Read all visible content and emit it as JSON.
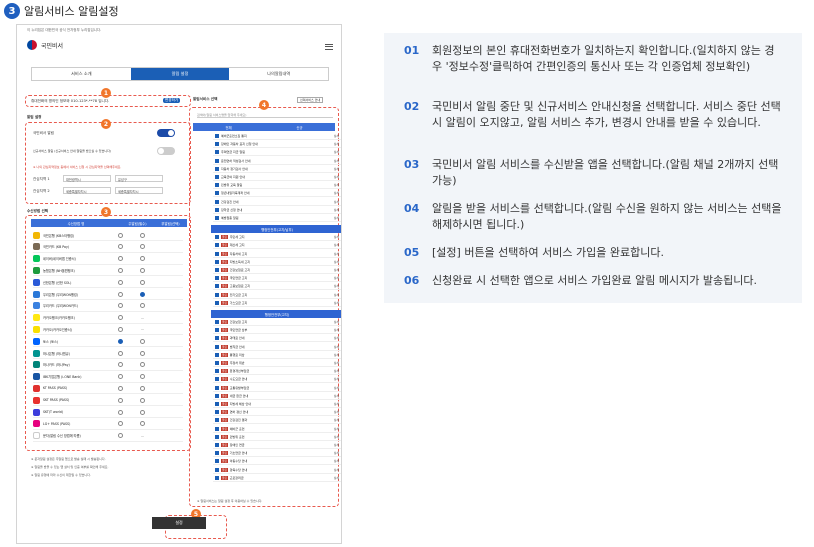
{
  "section": {
    "number": "3",
    "title": "알림서비스 알림설정"
  },
  "phone": {
    "top_note": "이 누리집은 대한민국 공식 전자정부 누리집입니다.",
    "brand": "국민비서",
    "tabs": [
      "서비스 소개",
      "알림 설정",
      "나의알림내역"
    ],
    "verify_text": "휴대전화의 명의인 정보와 010-123*-**78 입니다.",
    "verify_btn": "변경하기",
    "alarm_setting_label": "알림 설정",
    "stop_label": "국민비서 알림",
    "new_service_label": "신규서비스 알림 (신규서비스 안내 알림을 받으실 수 있습니다)",
    "region_note": "※ 나의 관심지역정보 등에서 서비스 신청 시 관심지역을 선택해주세요.",
    "region1_label": "관심지역 1",
    "region1_a": "대전광역시",
    "region1_b": "유성구",
    "region2_label": "관심지역 2",
    "region2_a": "세종특별자치시",
    "region2_b": "세종특별자치시",
    "app_section_label": "수신방법 선택",
    "app_head": [
      "수신방법 명",
      "주알림(필수)",
      "부알림(선택)"
    ],
    "apps": [
      {
        "name": "국민은행 (KB스타뱅킹)",
        "color": "#f2b705",
        "main": false,
        "sub": "radio"
      },
      {
        "name": "국민카드 (KB Pay)",
        "color": "#7a6a55",
        "main": false,
        "sub": "radio"
      },
      {
        "name": "네이버(네이버앱 인증서)",
        "color": "#03c75a",
        "main": false,
        "sub": "radio"
      },
      {
        "name": "농협은행 (NH올원뱅크)",
        "color": "#1d9b3e",
        "main": false,
        "sub": "radio"
      },
      {
        "name": "신한은행 (신한 SOL)",
        "color": "#2a5ad8",
        "main": false,
        "sub": "radio"
      },
      {
        "name": "우리은행 (우리WON뱅킹)",
        "color": "#2a78d8",
        "main": false,
        "sub": "radio-on"
      },
      {
        "name": "우리카드 (우리WON카드)",
        "color": "#3b82e0",
        "main": false,
        "sub": "radio"
      },
      {
        "name": "카카오뱅크(카카오뱅크)",
        "color": "#ffe812",
        "main": false,
        "sub": "-"
      },
      {
        "name": "카카오(카카오인증서)",
        "color": "#f9e000",
        "main": false,
        "sub": "-"
      },
      {
        "name": "토스 (토스)",
        "color": "#0064ff",
        "main": true,
        "sub": "radio"
      },
      {
        "name": "하나은행 (하나원큐)",
        "color": "#009490",
        "main": false,
        "sub": "radio"
      },
      {
        "name": "하나카드 (하나Pay)",
        "color": "#00857a",
        "main": false,
        "sub": "radio"
      },
      {
        "name": "IBK기업은행 (i-ONE Bank)",
        "color": "#1855a3",
        "main": false,
        "sub": "radio"
      },
      {
        "name": "KT PASS (PASS)",
        "color": "#e0312e",
        "main": false,
        "sub": "radio"
      },
      {
        "name": "SKT PASS (PASS)",
        "color": "#e8312e",
        "main": false,
        "sub": "radio"
      },
      {
        "name": "SKT(T world)",
        "color": "#3c3cdc",
        "main": false,
        "sub": "radio"
      },
      {
        "name": "LG+ PASS (PASS)",
        "color": "#e6007e",
        "main": false,
        "sub": "radio"
      },
      {
        "name": "문자(알림 수신 방법에 따름)",
        "color": "#ffffff",
        "main": false,
        "sub": "-"
      }
    ],
    "footnotes": [
      "※ 문자알림 설정은 주알림 앱으로 발송 실패 시 발송됩니다.",
      "※ 알림을 받을 수 있는 앱 설치 및 인증 여부를 확인해 주세요.",
      "※ 알림 유형에 따라 수신이 제한될 수 있습니다."
    ],
    "svc_label": "알림서비스 선택",
    "svc_search_placeholder": "검색어(알림 서비스명을 입력해 주세요)",
    "svc_all_btn": "선택서비스 안내",
    "svc_head": [
      "전체",
      "신규"
    ],
    "svc_group1": [
      "예비군훈련소집 통지",
      "장애인 자동차 표지 신청 안내",
      "주택연금 지급 알림",
      "운전면허 적성검사 안내",
      "자동차 정기검사 안내",
      "교육급여 지원 안내",
      "민방위 교육 알림",
      "청년내일저축계좌 안내",
      "건강검진 안내",
      "장학금 신청 안내",
      "예방접종 알림"
    ],
    "grp_head1": "행정안전부(고지/납부)",
    "svc_group2": [
      "주민세 고지",
      "재산세 고지",
      "자동차세 고지",
      "지방소득세 고지",
      "건강보험료 고지",
      "국민연금 고지",
      "고용보험료 고지",
      "전기요금 고지",
      "가스요금 고지"
    ],
    "grp_head2": "행정안전부(고지)",
    "svc_group3": [
      "건강보험 고지",
      "국민연금 납부",
      "과태료 안내",
      "범칙금 안내",
      "통행료 미납",
      "주정차 위반",
      "환경개선부담금",
      "수도요금 안내",
      "교통유발부담금",
      "세금 환급 안내",
      "지방세 체납 안내",
      "면허 갱신 안내",
      "건강검진 결과",
      "예비군 훈련",
      "민방위 훈련",
      "장애인 연금",
      "기초연금 안내",
      "아동수당 안내",
      "양육수당 안내",
      "근로장려금"
    ],
    "svc_footer": "※ 알림서비스는 알림 설정 후 이용하실 수 있습니다.",
    "set_btn": "설정",
    "badges": [
      "1",
      "2",
      "3",
      "4",
      "5"
    ]
  },
  "steps": [
    {
      "n": "01",
      "text": "회원정보의 본인 휴대전화번호가 일치하는지 확인합니다.(일치하지 않는 경우 '정보수정'클릭하여 간편인증의 통신사 또는 각 인증업체 정보확인)"
    },
    {
      "n": "02",
      "text": "국민비서 알림 중단 및 신규서비스 안내신청을 선택합니다. 서비스 중단 선택시 알림이 오지않고, 알림 서비스 추가, 변경시 안내를 받을 수 있습니다."
    },
    {
      "n": "03",
      "text": "국민비서 알림 서비스를 수신받을 앱을 선택합니다.(알림 채널 2개까지 선택 가능)"
    },
    {
      "n": "04",
      "text": "알림을 받을 서비스를 선택합니다.(알림 수신을 원하지 않는 서비스는 선택을 해제하시면 됩니다.)"
    },
    {
      "n": "05",
      "text": "[설정] 버튼을 선택하여 서비스 가입을 완료합니다."
    },
    {
      "n": "06",
      "text": "신청완료 시 선택한 앱으로 서비스 가입완료 알림 메시지가 발송됩니다."
    }
  ]
}
